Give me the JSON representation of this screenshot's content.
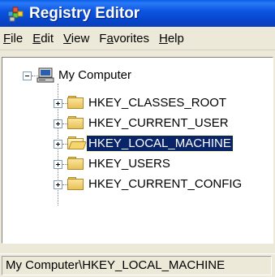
{
  "window": {
    "title": "Registry Editor"
  },
  "menu": [
    {
      "underline": "F",
      "rest": "ile"
    },
    {
      "underline": "E",
      "rest": "dit"
    },
    {
      "underline": "V",
      "rest": "iew"
    },
    {
      "pre": "F",
      "underline": "a",
      "rest": "vorites"
    },
    {
      "underline": "H",
      "rest": "elp"
    }
  ],
  "tree": {
    "root": {
      "label": "My Computer",
      "expanded": true
    },
    "keys": [
      {
        "label": "HKEY_CLASSES_ROOT",
        "selected": false
      },
      {
        "label": "HKEY_CURRENT_USER",
        "selected": false
      },
      {
        "label": "HKEY_LOCAL_MACHINE",
        "selected": true
      },
      {
        "label": "HKEY_USERS",
        "selected": false
      },
      {
        "label": "HKEY_CURRENT_CONFIG",
        "selected": false
      }
    ]
  },
  "status": {
    "path": "My Computer\\HKEY_LOCAL_MACHINE"
  }
}
